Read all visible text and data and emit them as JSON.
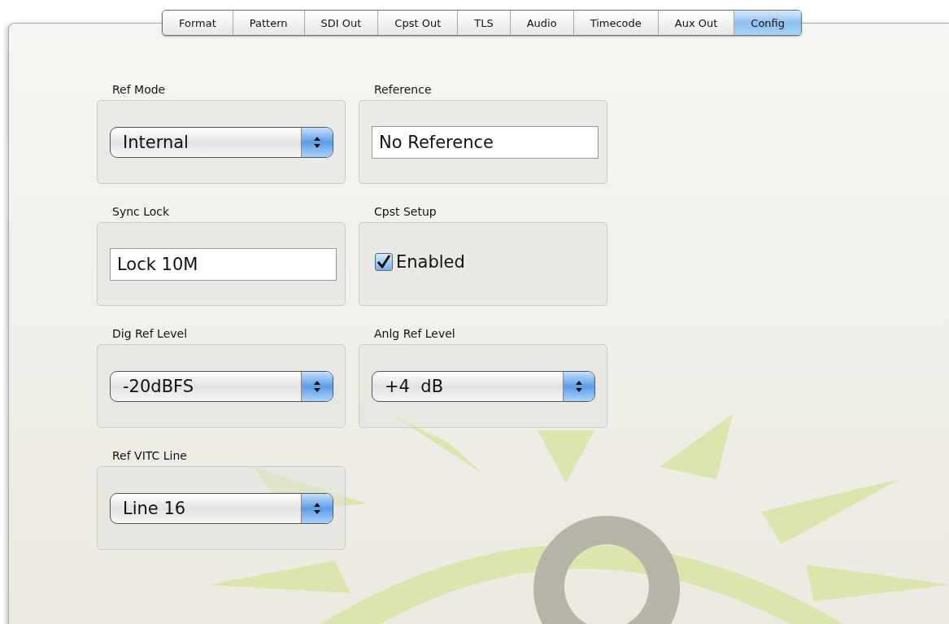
{
  "tabs": [
    {
      "label": "Format",
      "selected": false
    },
    {
      "label": "Pattern",
      "selected": false
    },
    {
      "label": "SDI Out",
      "selected": false
    },
    {
      "label": "Cpst Out",
      "selected": false
    },
    {
      "label": "TLS",
      "selected": false
    },
    {
      "label": "Audio",
      "selected": false
    },
    {
      "label": "Timecode",
      "selected": false
    },
    {
      "label": "Aux Out",
      "selected": false
    },
    {
      "label": "Config",
      "selected": true
    }
  ],
  "groups": [
    {
      "label": "Ref Mode",
      "kind": "popup",
      "value": "Internal"
    },
    {
      "label": "Reference",
      "kind": "field",
      "value": "No Reference"
    },
    {
      "label": "Sync Lock",
      "kind": "field",
      "value": "Lock 10M"
    },
    {
      "label": "Cpst Setup",
      "kind": "checkbox",
      "value": "Enabled",
      "checked": true
    },
    {
      "label": "Dig Ref Level",
      "kind": "popup",
      "value": "-20dBFS"
    },
    {
      "label": "Anlg Ref Level",
      "kind": "popup",
      "value": "+4  dB"
    },
    {
      "label": "Ref VITC Line",
      "kind": "popup",
      "value": "Line 16"
    }
  ]
}
